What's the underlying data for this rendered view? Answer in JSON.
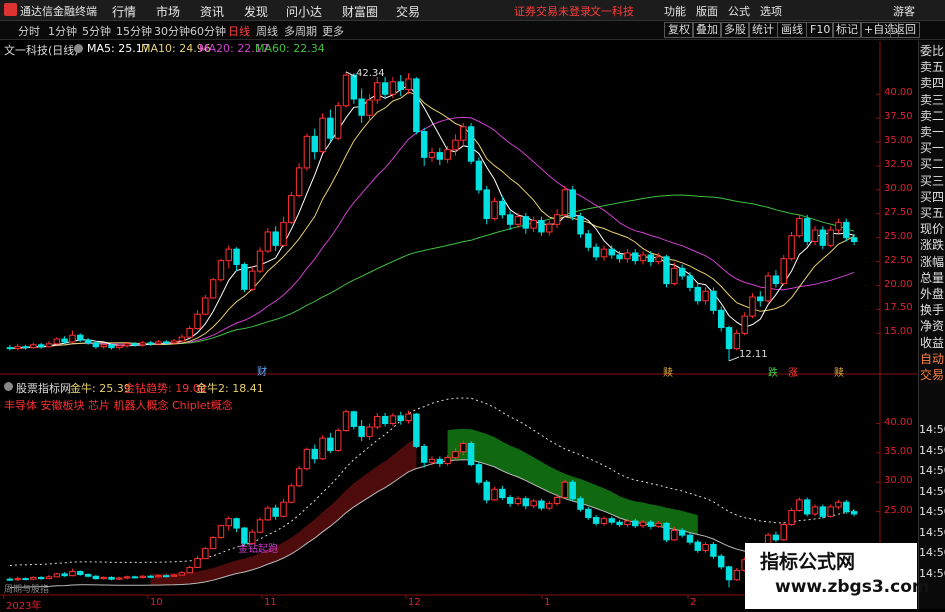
{
  "app": {
    "name": "通达信金融终端"
  },
  "menu": [
    "行情",
    "市场",
    "资讯",
    "发现",
    "问小达",
    "财富圈",
    "交易"
  ],
  "notice": {
    "login": "证券交易未登录",
    "stock": "文一科技"
  },
  "right_menu": [
    "功能",
    "版面",
    "公式",
    "选项"
  ],
  "user": "游客",
  "periods": [
    "分时",
    "1分钟",
    "5分钟",
    "15分钟",
    "30分钟",
    "60分钟",
    "日线",
    "周线",
    "多周期",
    "更多"
  ],
  "active_period": "日线",
  "tools": [
    "复权",
    "叠加",
    "多股",
    "统计",
    "画线",
    "F10",
    "标记",
    "+自选",
    "返回"
  ],
  "main": {
    "title": "文一科技(日线)",
    "ma5": "MA5: 25.17",
    "ma10": "MA10: 24.96",
    "ma20": "MA20: 22.17",
    "ma60": "MA60: 22.34",
    "high_label": "42.34",
    "low_label": "12.11",
    "event_cai": "财",
    "event_shu1": "赎",
    "event_die": "跌",
    "event_zhang": "涨",
    "event_shu2": "赎",
    "price_ticks": [
      "40.00",
      "37.50",
      "35.00",
      "32.50",
      "30.00",
      "27.50",
      "25.00",
      "22.50",
      "20.00",
      "17.50",
      "15.00"
    ]
  },
  "sub": {
    "title": "股票指标网",
    "jinniu": "金牛: 25.39",
    "zuanjin": "金钻趋势: 19.02",
    "jinniu2": "金牛2: 18.41",
    "tags": "丰导体 安徽板块 芯片 机器人概念 Chiplet概念",
    "badge": "金钻起跑",
    "bottom_label": "周期与股指",
    "price_ticks": [
      "40.00",
      "35.00",
      "30.00",
      "25.00"
    ]
  },
  "right_panel": [
    "委比",
    "卖五",
    "卖四",
    "卖三",
    "卖二",
    "卖一",
    "买一",
    "买二",
    "买三",
    "买四",
    "买五",
    "现价",
    "涨跌",
    "涨幅",
    "总量",
    "外盘",
    "换手",
    "净资",
    "收益",
    "自动",
    "交易"
  ],
  "times": [
    "14:50",
    "14:50",
    "14:50",
    "14:50",
    "14:50",
    "14:50",
    "14:50",
    "14:50"
  ],
  "x_labels": [
    "2023年",
    "10",
    "11",
    "12",
    "1",
    "2"
  ],
  "watermark": {
    "title": "指标公式网",
    "url": "www.zbgs3.com"
  },
  "colors": {
    "up": "#ff3030",
    "down": "#00e0e0",
    "ma5": "#ffffff",
    "ma10": "#e8d070",
    "ma20": "#d040d0",
    "ma60": "#40c040"
  },
  "chart_data": {
    "type": "candlestick",
    "title": "文一科技(日线)",
    "ylim": [
      12,
      44
    ],
    "candles": [
      [
        13.5,
        13.4,
        13.8,
        13.2
      ],
      [
        13.4,
        13.6,
        13.9,
        13.2
      ],
      [
        13.6,
        13.5,
        13.8,
        13.3
      ],
      [
        13.5,
        13.8,
        14.0,
        13.4
      ],
      [
        13.8,
        13.6,
        14.0,
        13.4
      ],
      [
        13.6,
        13.9,
        14.2,
        13.5
      ],
      [
        13.9,
        14.4,
        14.6,
        13.8
      ],
      [
        14.4,
        14.1,
        14.7,
        13.9
      ],
      [
        14.1,
        14.8,
        15.3,
        14.0
      ],
      [
        14.8,
        14.3,
        15.0,
        14.1
      ],
      [
        14.3,
        14.0,
        14.5,
        13.8
      ],
      [
        14.0,
        13.6,
        14.2,
        13.4
      ],
      [
        13.6,
        13.8,
        14.0,
        13.4
      ],
      [
        13.8,
        13.5,
        14.0,
        13.3
      ],
      [
        13.5,
        13.7,
        13.9,
        13.3
      ],
      [
        13.7,
        13.9,
        14.1,
        13.5
      ],
      [
        13.9,
        13.8,
        14.1,
        13.6
      ],
      [
        13.8,
        14.0,
        14.2,
        13.6
      ],
      [
        14.0,
        13.9,
        14.2,
        13.7
      ],
      [
        13.9,
        14.1,
        14.3,
        13.8
      ],
      [
        14.1,
        14.0,
        14.3,
        13.8
      ],
      [
        14.0,
        14.2,
        14.4,
        13.9
      ],
      [
        14.2,
        14.6,
        14.9,
        14.1
      ],
      [
        14.6,
        15.5,
        15.8,
        14.5
      ],
      [
        15.5,
        17.0,
        17.4,
        15.4
      ],
      [
        17.0,
        18.7,
        19.0,
        16.9
      ],
      [
        18.7,
        20.6,
        20.8,
        18.6
      ],
      [
        20.6,
        22.6,
        22.8,
        20.4
      ],
      [
        22.6,
        23.8,
        24.2,
        21.8
      ],
      [
        23.8,
        22.2,
        24.0,
        21.5
      ],
      [
        22.2,
        19.6,
        22.4,
        19.3
      ],
      [
        19.6,
        21.5,
        22.0,
        19.4
      ],
      [
        21.5,
        23.6,
        24.0,
        21.3
      ],
      [
        23.6,
        25.6,
        26.0,
        23.4
      ],
      [
        25.6,
        24.2,
        26.2,
        23.6
      ],
      [
        24.2,
        26.6,
        27.2,
        24.0
      ],
      [
        26.6,
        29.4,
        29.8,
        26.4
      ],
      [
        29.4,
        32.3,
        32.8,
        29.2
      ],
      [
        32.3,
        35.6,
        35.9,
        32.0
      ],
      [
        35.6,
        34.0,
        36.4,
        33.2
      ],
      [
        34.0,
        37.5,
        38.0,
        33.8
      ],
      [
        37.5,
        35.4,
        38.4,
        35.0
      ],
      [
        35.4,
        38.8,
        39.2,
        35.2
      ],
      [
        38.8,
        42.0,
        42.34,
        38.6
      ],
      [
        42.0,
        39.5,
        42.2,
        39.0
      ],
      [
        39.5,
        37.8,
        40.6,
        37.0
      ],
      [
        37.8,
        39.4,
        40.0,
        37.2
      ],
      [
        39.4,
        41.2,
        41.8,
        39.0
      ],
      [
        41.2,
        40.0,
        41.8,
        39.5
      ],
      [
        40.0,
        41.3,
        41.8,
        39.6
      ],
      [
        41.3,
        40.5,
        42.0,
        39.8
      ],
      [
        40.5,
        41.6,
        42.2,
        40.0
      ],
      [
        41.6,
        36.1,
        41.8,
        35.8
      ],
      [
        36.1,
        33.4,
        36.5,
        32.5
      ],
      [
        33.4,
        33.9,
        34.4,
        32.9
      ],
      [
        33.9,
        33.2,
        34.4,
        32.6
      ],
      [
        33.2,
        34.2,
        34.6,
        32.8
      ],
      [
        34.2,
        35.2,
        35.8,
        33.6
      ],
      [
        35.2,
        36.6,
        37.0,
        34.6
      ],
      [
        36.6,
        33.0,
        37.0,
        32.7
      ],
      [
        33.0,
        30.0,
        33.4,
        29.6
      ],
      [
        30.0,
        27.0,
        30.4,
        26.4
      ],
      [
        27.0,
        28.8,
        29.2,
        26.8
      ],
      [
        28.8,
        27.4,
        29.4,
        27.0
      ],
      [
        27.4,
        26.4,
        27.8,
        25.8
      ],
      [
        26.4,
        27.2,
        27.6,
        26.0
      ],
      [
        27.2,
        26.0,
        27.6,
        25.4
      ],
      [
        26.0,
        26.8,
        27.2,
        25.6
      ],
      [
        26.8,
        25.6,
        27.2,
        25.2
      ],
      [
        25.6,
        26.4,
        26.8,
        25.2
      ],
      [
        26.4,
        27.4,
        28.0,
        26.0
      ],
      [
        27.4,
        30.0,
        30.4,
        27.2
      ],
      [
        30.0,
        27.2,
        30.4,
        26.8
      ],
      [
        27.2,
        25.4,
        27.6,
        25.0
      ],
      [
        25.4,
        24.0,
        25.8,
        23.6
      ],
      [
        24.0,
        23.0,
        24.4,
        22.6
      ],
      [
        23.0,
        23.8,
        24.2,
        22.6
      ],
      [
        23.8,
        23.2,
        24.2,
        22.8
      ],
      [
        23.2,
        22.8,
        23.6,
        22.4
      ],
      [
        22.8,
        23.4,
        23.8,
        22.4
      ],
      [
        23.4,
        22.6,
        23.8,
        22.2
      ],
      [
        22.6,
        23.2,
        23.6,
        22.2
      ],
      [
        23.2,
        22.5,
        23.6,
        22.0
      ],
      [
        22.5,
        23.0,
        23.4,
        22.2
      ],
      [
        23.0,
        20.2,
        23.2,
        19.8
      ],
      [
        20.2,
        21.8,
        22.4,
        20.0
      ],
      [
        21.8,
        21.0,
        22.2,
        20.6
      ],
      [
        21.0,
        19.8,
        21.4,
        19.4
      ],
      [
        19.8,
        18.4,
        20.2,
        18.0
      ],
      [
        18.4,
        19.4,
        19.8,
        18.0
      ],
      [
        19.4,
        17.4,
        19.8,
        17.0
      ],
      [
        17.4,
        15.6,
        17.8,
        15.2
      ],
      [
        15.6,
        13.4,
        15.8,
        12.11
      ],
      [
        13.4,
        15.0,
        15.4,
        13.2
      ],
      [
        15.0,
        16.8,
        17.2,
        14.8
      ],
      [
        16.8,
        18.8,
        19.2,
        16.6
      ],
      [
        18.8,
        18.4,
        19.4,
        17.8
      ],
      [
        18.4,
        21.0,
        21.4,
        18.2
      ],
      [
        21.0,
        20.2,
        21.6,
        19.8
      ],
      [
        20.2,
        22.8,
        23.2,
        20.0
      ],
      [
        22.8,
        25.2,
        25.6,
        22.6
      ],
      [
        25.2,
        27.0,
        27.4,
        25.0
      ],
      [
        27.0,
        24.6,
        27.4,
        24.2
      ],
      [
        24.6,
        25.8,
        26.2,
        24.2
      ],
      [
        25.8,
        24.2,
        26.2,
        23.8
      ],
      [
        24.2,
        25.8,
        26.2,
        24.0
      ],
      [
        25.8,
        26.6,
        27.0,
        25.4
      ],
      [
        26.6,
        25.0,
        27.0,
        24.6
      ],
      [
        25.0,
        24.6,
        25.4,
        24.2
      ]
    ]
  }
}
